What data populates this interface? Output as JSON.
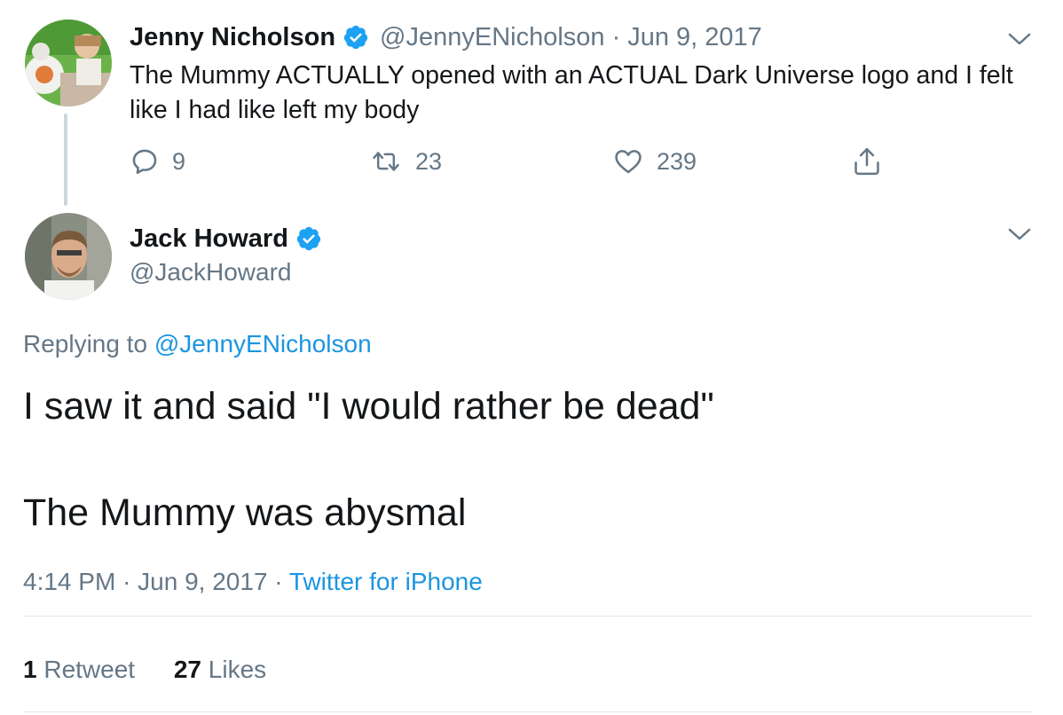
{
  "parent_tweet": {
    "author_name": "Jenny Nicholson",
    "author_handle": "@JennyENicholson",
    "separator": "·",
    "date": "Jun 9, 2017",
    "text": "The Mummy ACTUALLY opened with an ACTUAL Dark Universe logo and I felt like I had like left my body",
    "actions": {
      "replies": "9",
      "retweets": "23",
      "likes": "239"
    },
    "icons": [
      "verified-badge-icon",
      "chevron-down-icon",
      "reply-icon",
      "retweet-icon",
      "heart-icon",
      "share-icon"
    ]
  },
  "reply_tweet": {
    "author_name": "Jack Howard",
    "author_handle": "@JackHoward",
    "replying_label": "Replying to",
    "replying_handle": "@JennyENicholson",
    "text_line1": "I saw it and said \"I would rather be dead\"",
    "text_line2": "The Mummy was abysmal",
    "time": "4:14 PM",
    "sep1": "·",
    "date": "Jun 9, 2017",
    "sep2": "·",
    "source": "Twitter for iPhone",
    "retweet_count": "1",
    "retweet_label": "Retweet",
    "like_count": "27",
    "like_label": "Likes"
  },
  "colors": {
    "text": "#14171a",
    "muted": "#657786",
    "link": "#1b95e0",
    "verified": "#1da1f2",
    "divider": "#e1e8ed",
    "thread_line": "#ccd6dd"
  }
}
